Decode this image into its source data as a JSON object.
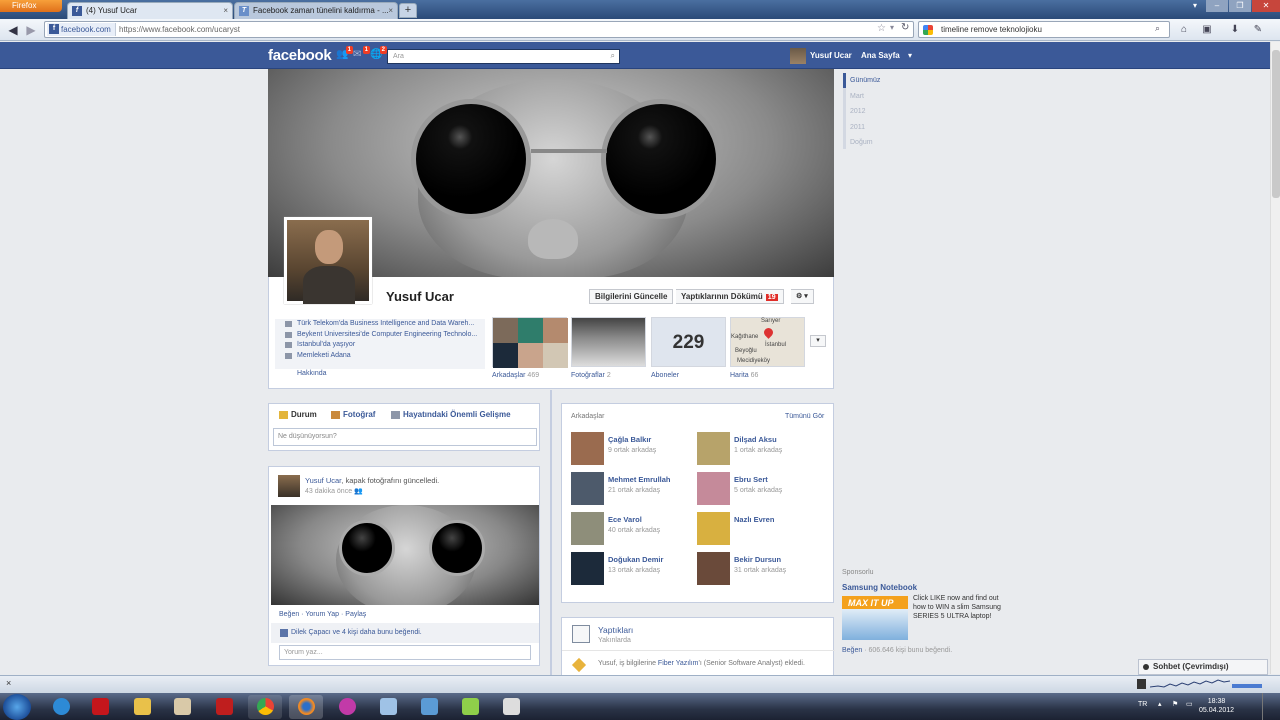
{
  "browser": {
    "app_button": "Firefox",
    "tabs": [
      {
        "label": "(4) Yusuf Ucar"
      },
      {
        "label": "Facebook zaman tünelini kaldırma - ..."
      }
    ],
    "url_identity": "facebook.com",
    "url": "https://www.facebook.com/ucaryst",
    "search_value": "timeline remove teknolojioku"
  },
  "fb_header": {
    "logo": "facebook",
    "jewel_badges": [
      "1",
      "1",
      "2"
    ],
    "search_placeholder": "Ara",
    "user_name": "Yusuf Ucar",
    "home_label": "Ana Sayfa"
  },
  "profile": {
    "name": "Yusuf Ucar",
    "update_info_button": "Bilgilerini Güncelle",
    "activity_log_button": "Yaptıklarının Dökümü",
    "activity_log_count": "19",
    "info": [
      "Türk Telekom'da Business Intelligence and Data Wareh...",
      "Beykent Üniversitesi'de Computer Engineering Technolo...",
      "İstanbul'da yaşıyor",
      "Memleketi Adana"
    ],
    "about_link": "Hakkında",
    "apps": [
      {
        "label": "Arkadaşlar",
        "count": "469"
      },
      {
        "label": "Fotoğraflar",
        "count": "2"
      },
      {
        "label": "Aboneler",
        "count": ""
      },
      {
        "label": "Harita",
        "count": "66"
      }
    ],
    "subscriber_count": "229",
    "map_labels": [
      "Sarıyer",
      "Kağıthane",
      "İstanbul",
      "Beyoğlu",
      "Mecidiyeköy"
    ]
  },
  "composer": {
    "tabs": [
      "Durum",
      "Fotoğraf",
      "Hayatındaki Önemli Gelişme"
    ],
    "placeholder": "Ne düşünüyorsun?"
  },
  "post": {
    "author": "Yusuf Ucar",
    "action": ", kapak fotoğrafını güncelledi.",
    "time": "43 dakika önce",
    "actions": "Beğen · Yorum Yap · Paylaş",
    "likes": "Dilek Çapacı ve 4 kişi daha bunu beğendi.",
    "comment_placeholder": "Yorum yaz..."
  },
  "friends_box": {
    "title": "Arkadaşlar",
    "see_all": "Tümünü Gör",
    "friends": [
      {
        "name": "Çağla Balkır",
        "mutual": "9 ortak arkadaş",
        "color": "#9a6b4f"
      },
      {
        "name": "Dilşad Aksu",
        "mutual": "1 ortak arkadaş",
        "color": "#b7a36a"
      },
      {
        "name": "Mehmet Emrullah",
        "mutual": "21 ortak arkadaş",
        "color": "#4d5a6b"
      },
      {
        "name": "Ebru Sert",
        "mutual": "5 ortak arkadaş",
        "color": "#c58a9a"
      },
      {
        "name": "Ece Varol",
        "mutual": "40 ortak arkadaş",
        "color": "#8e8e7a"
      },
      {
        "name": "Nazlı Evren",
        "mutual": "",
        "color": "#d8b040"
      },
      {
        "name": "Doğukan Demir",
        "mutual": "13 ortak arkadaş",
        "color": "#1c2a3a"
      },
      {
        "name": "Bekir Dursun",
        "mutual": "31 ortak arkadaş",
        "color": "#6a4a3a"
      }
    ]
  },
  "activity_box": {
    "title": "Yaptıkları",
    "subtitle": "Yakınlarda",
    "text_prefix": "Yusuf, iş bilgilerine ",
    "text_link": "Fiber Yazılım",
    "text_suffix": "'ı (Senior Software Analyst) ekledi."
  },
  "scrubber": [
    "Günümüz",
    "Mart",
    "2012",
    "2011",
    "Doğum"
  ],
  "ad": {
    "sponsored_label": "Sponsorlu",
    "title": "Samsung Notebook",
    "image_text": "MAX IT UP",
    "text": "Click LIKE now and find out how to WIN a slim Samsung SERIES 5 ULTRA laptop!",
    "like_label": "Beğen",
    "like_count": " · 606.646 kişi bunu beğendi."
  },
  "chat": {
    "label": "Sohbet (Çevrimdışı)"
  },
  "taskbar": {
    "lang": "TR",
    "time": "18:38",
    "date": "05.04.2012"
  },
  "colors": {
    "fb_blue": "#3b5998",
    "badge_red": "#f03d25"
  }
}
